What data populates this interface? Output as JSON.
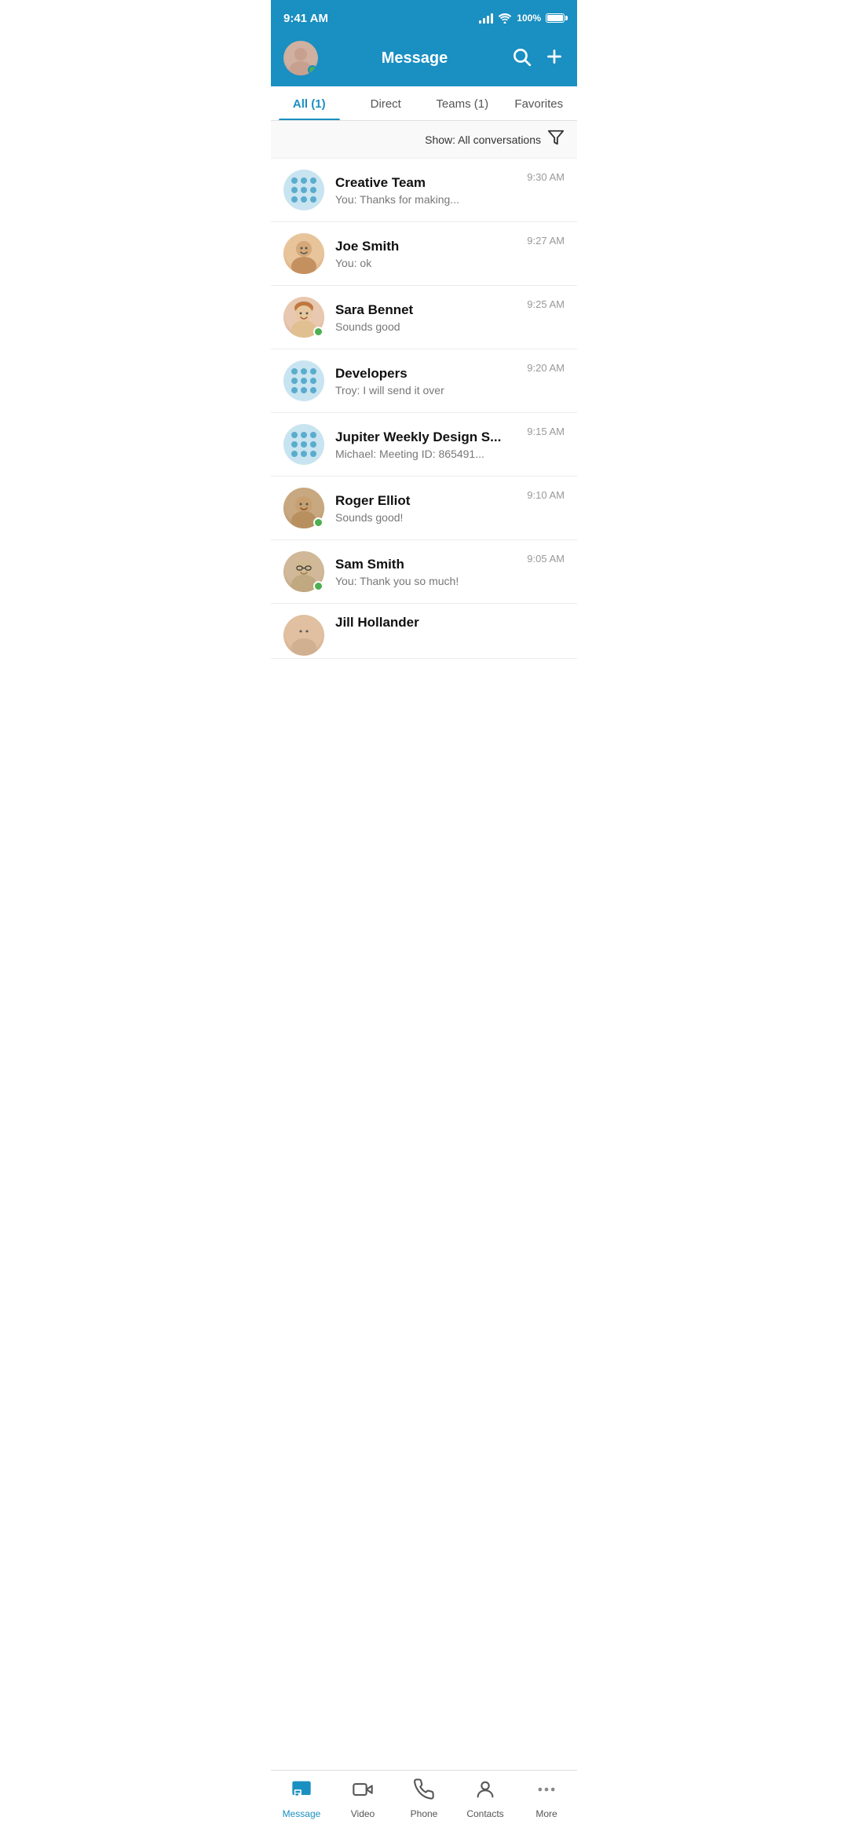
{
  "statusBar": {
    "time": "9:41 AM",
    "battery": "100%"
  },
  "header": {
    "title": "Message",
    "searchLabel": "Search",
    "addLabel": "Add"
  },
  "tabs": [
    {
      "id": "all",
      "label": "All (1)",
      "active": true
    },
    {
      "id": "direct",
      "label": "Direct",
      "active": false
    },
    {
      "id": "teams",
      "label": "Teams (1)",
      "active": false
    },
    {
      "id": "favorites",
      "label": "Favorites",
      "active": false
    }
  ],
  "filter": {
    "label": "Show: All conversations"
  },
  "conversations": [
    {
      "id": "creative-team",
      "name": "Creative Team",
      "preview": "You: Thanks for making...",
      "time": "9:30 AM",
      "type": "group",
      "online": false
    },
    {
      "id": "joe-smith",
      "name": "Joe Smith",
      "preview": "You: ok",
      "time": "9:27 AM",
      "type": "person",
      "online": false,
      "faceClass": "face-joe"
    },
    {
      "id": "sara-bennet",
      "name": "Sara Bennet",
      "preview": "Sounds good",
      "time": "9:25 AM",
      "type": "person",
      "online": true,
      "faceClass": "face-sara"
    },
    {
      "id": "developers",
      "name": "Developers",
      "preview": "Troy: I will send it over",
      "time": "9:20 AM",
      "type": "group",
      "online": false
    },
    {
      "id": "jupiter-weekly",
      "name": "Jupiter Weekly Design S...",
      "preview": "Michael: Meeting ID: 865491...",
      "time": "9:15 AM",
      "type": "group",
      "online": false
    },
    {
      "id": "roger-elliot",
      "name": "Roger Elliot",
      "preview": "Sounds good!",
      "time": "9:10 AM",
      "type": "person",
      "online": true,
      "faceClass": "face-roger"
    },
    {
      "id": "sam-smith",
      "name": "Sam Smith",
      "preview": "You: Thank you so much!",
      "time": "9:05 AM",
      "type": "person",
      "online": true,
      "faceClass": "face-sam"
    },
    {
      "id": "jill-hollander",
      "name": "Jill Hollander",
      "preview": "",
      "time": "",
      "type": "person",
      "online": false,
      "faceClass": "face-jill"
    }
  ],
  "bottomNav": [
    {
      "id": "message",
      "label": "Message",
      "icon": "message",
      "active": true
    },
    {
      "id": "video",
      "label": "Video",
      "icon": "video",
      "active": false
    },
    {
      "id": "phone",
      "label": "Phone",
      "icon": "phone",
      "active": false
    },
    {
      "id": "contacts",
      "label": "Contacts",
      "icon": "contacts",
      "active": false
    },
    {
      "id": "more",
      "label": "More",
      "icon": "more",
      "active": false
    }
  ]
}
